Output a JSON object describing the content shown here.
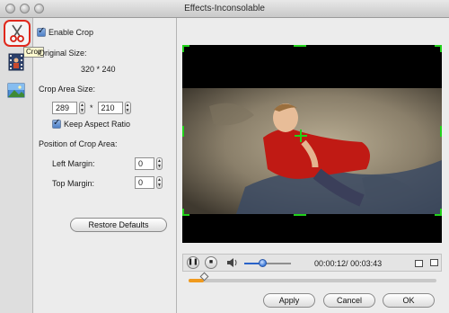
{
  "window": {
    "title": "Effects-Inconsolable"
  },
  "sidebar": {
    "tools": [
      {
        "name": "Crop",
        "icon": "scissors-icon",
        "selected": true
      },
      {
        "name": "Effect",
        "icon": "film-strip-icon",
        "selected": false
      },
      {
        "name": "Picture",
        "icon": "picture-icon",
        "selected": false
      }
    ],
    "tooltip": "Crop"
  },
  "crop": {
    "enable_label": "Enable Crop",
    "enable_checked": true,
    "original_size_label": "Original Size:",
    "original_size_value": "320 * 240",
    "crop_area_label": "Crop Area Size:",
    "width": "289",
    "separator": "*",
    "height": "210",
    "keep_aspect_label": "Keep Aspect Ratio",
    "keep_aspect_checked": true,
    "position_label": "Position of Crop Area:",
    "left_margin_label": "Left Margin:",
    "left_margin_value": "0",
    "top_margin_label": "Top Margin:",
    "top_margin_value": "0",
    "restore_label": "Restore Defaults"
  },
  "player": {
    "current_time": "00:00:12",
    "total_time": "00:03:43",
    "time_separator": "/ ",
    "volume_fraction": 0.38,
    "progress_fraction": 0.06
  },
  "footer": {
    "apply_label": "Apply",
    "cancel_label": "Cancel",
    "ok_label": "OK"
  },
  "colors": {
    "crop_guides": "#21d11a",
    "tool_highlight": "#e0281c",
    "progress": "#f09a1e",
    "volume": "#2a63c9"
  }
}
